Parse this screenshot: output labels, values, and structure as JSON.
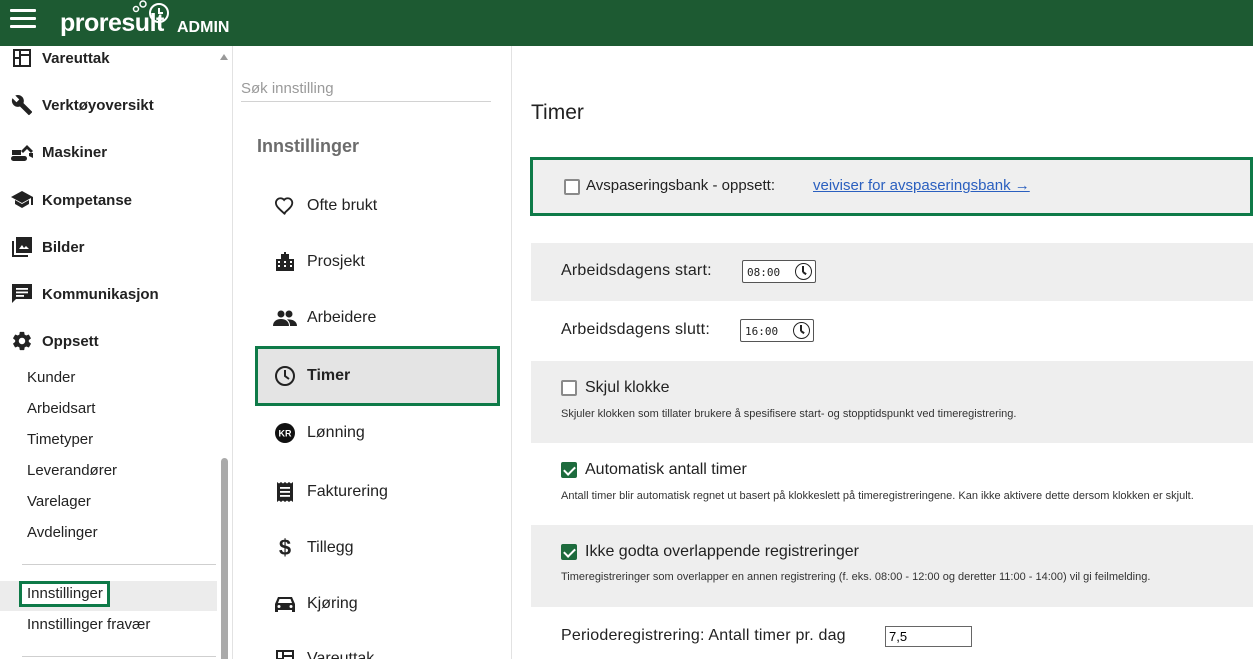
{
  "header": {
    "logo_text": "proresult",
    "admin_label": "ADMIN"
  },
  "colors": {
    "header_bg": "#1d5a32",
    "highlight": "#0e7a48",
    "link": "#2a5fbf"
  },
  "sidebar": {
    "items": [
      {
        "label": "Vareuttak",
        "icon": "dashboard-icon"
      },
      {
        "label": "Verktøyoversikt",
        "icon": "wrench-icon"
      },
      {
        "label": "Maskiner",
        "icon": "excavator-icon"
      },
      {
        "label": "Kompetanse",
        "icon": "school-icon"
      },
      {
        "label": "Bilder",
        "icon": "photo-library-icon"
      },
      {
        "label": "Kommunikasjon",
        "icon": "chat-icon"
      },
      {
        "label": "Oppsett",
        "icon": "gear-icon"
      }
    ],
    "sub_items": [
      "Kunder",
      "Arbeidsart",
      "Timetyper",
      "Leverandører",
      "Varelager",
      "Avdelinger"
    ],
    "settings_items": [
      "Innstillinger",
      "Innstillinger fravær"
    ]
  },
  "settings_nav": {
    "search_placeholder": "Søk innstilling",
    "title": "Innstillinger",
    "items": [
      {
        "label": "Ofte brukt",
        "icon": "heart-icon"
      },
      {
        "label": "Prosjekt",
        "icon": "city-icon"
      },
      {
        "label": "Arbeidere",
        "icon": "people-icon"
      },
      {
        "label": "Timer",
        "icon": "clock-icon"
      },
      {
        "label": "Lønning",
        "icon": "kr-icon"
      },
      {
        "label": "Fakturering",
        "icon": "receipt-icon"
      },
      {
        "label": "Tillegg",
        "icon": "dollar-icon"
      },
      {
        "label": "Kjøring",
        "icon": "car-icon"
      },
      {
        "label": "Vareuttak",
        "icon": "dashboard-icon"
      }
    ],
    "kr_text": "KR"
  },
  "main": {
    "title": "Timer",
    "bank": {
      "label": "Avspaseringsbank - oppsett:",
      "link": "veiviser for avspaseringsbank →"
    },
    "workday_start": {
      "label": "Arbeidsdagens start:",
      "value": "08:00"
    },
    "workday_end": {
      "label": "Arbeidsdagens slutt:",
      "value": "16:00"
    },
    "hide_clock": {
      "title": "Skjul klokke",
      "desc": "Skjuler klokken som tillater brukere å spesifisere start- og stopptidspunkt ved timeregistrering."
    },
    "auto_hours": {
      "title": "Automatisk antall timer",
      "desc": "Antall timer blir automatisk regnet ut basert på klokkeslett på timeregistreringene. Kan ikke aktivere dette dersom klokken er skjult."
    },
    "no_overlap": {
      "title": "Ikke godta overlappende registreringer",
      "desc": "Timeregistreringer som overlapper en annen registrering (f. eks. 08:00 - 12:00 og deretter 11:00 - 14:00) vil gi feilmelding."
    },
    "period": {
      "label": "Perioderegistrering: Antall timer pr. dag",
      "value": "7,5"
    }
  }
}
